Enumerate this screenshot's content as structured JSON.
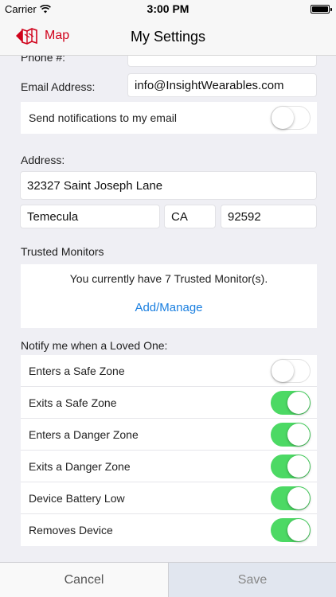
{
  "status_bar": {
    "carrier": "Carrier",
    "time": "3:00 PM"
  },
  "nav": {
    "back_label": "Map",
    "title": "My Settings"
  },
  "form": {
    "phone_label": "Phone #:",
    "phone_value": "",
    "email_label": "Email Address:",
    "email_value": "info@InsightWearables.com",
    "email_notify_label": "Send notifications to my email",
    "email_notify_on": false,
    "address_label": "Address:",
    "street": "32327 Saint Joseph Lane",
    "city": "Temecula",
    "state": "CA",
    "zip": "92592"
  },
  "trusted": {
    "heading": "Trusted Monitors",
    "message": "You currently have 7 Trusted Monitor(s).",
    "link_label": "Add/Manage"
  },
  "notify": {
    "heading": "Notify me when a Loved One:",
    "items": [
      {
        "label": "Enters a Safe Zone",
        "on": false
      },
      {
        "label": "Exits a Safe Zone",
        "on": true
      },
      {
        "label": "Enters a Danger Zone",
        "on": true
      },
      {
        "label": "Exits a Danger Zone",
        "on": true
      },
      {
        "label": "Device Battery Low",
        "on": true
      },
      {
        "label": "Removes Device",
        "on": true
      }
    ]
  },
  "footer": {
    "cancel_label": "Cancel",
    "save_label": "Save"
  },
  "colors": {
    "accent_red": "#d0021b",
    "link_blue": "#1a7fe0",
    "switch_on": "#4cd964"
  }
}
